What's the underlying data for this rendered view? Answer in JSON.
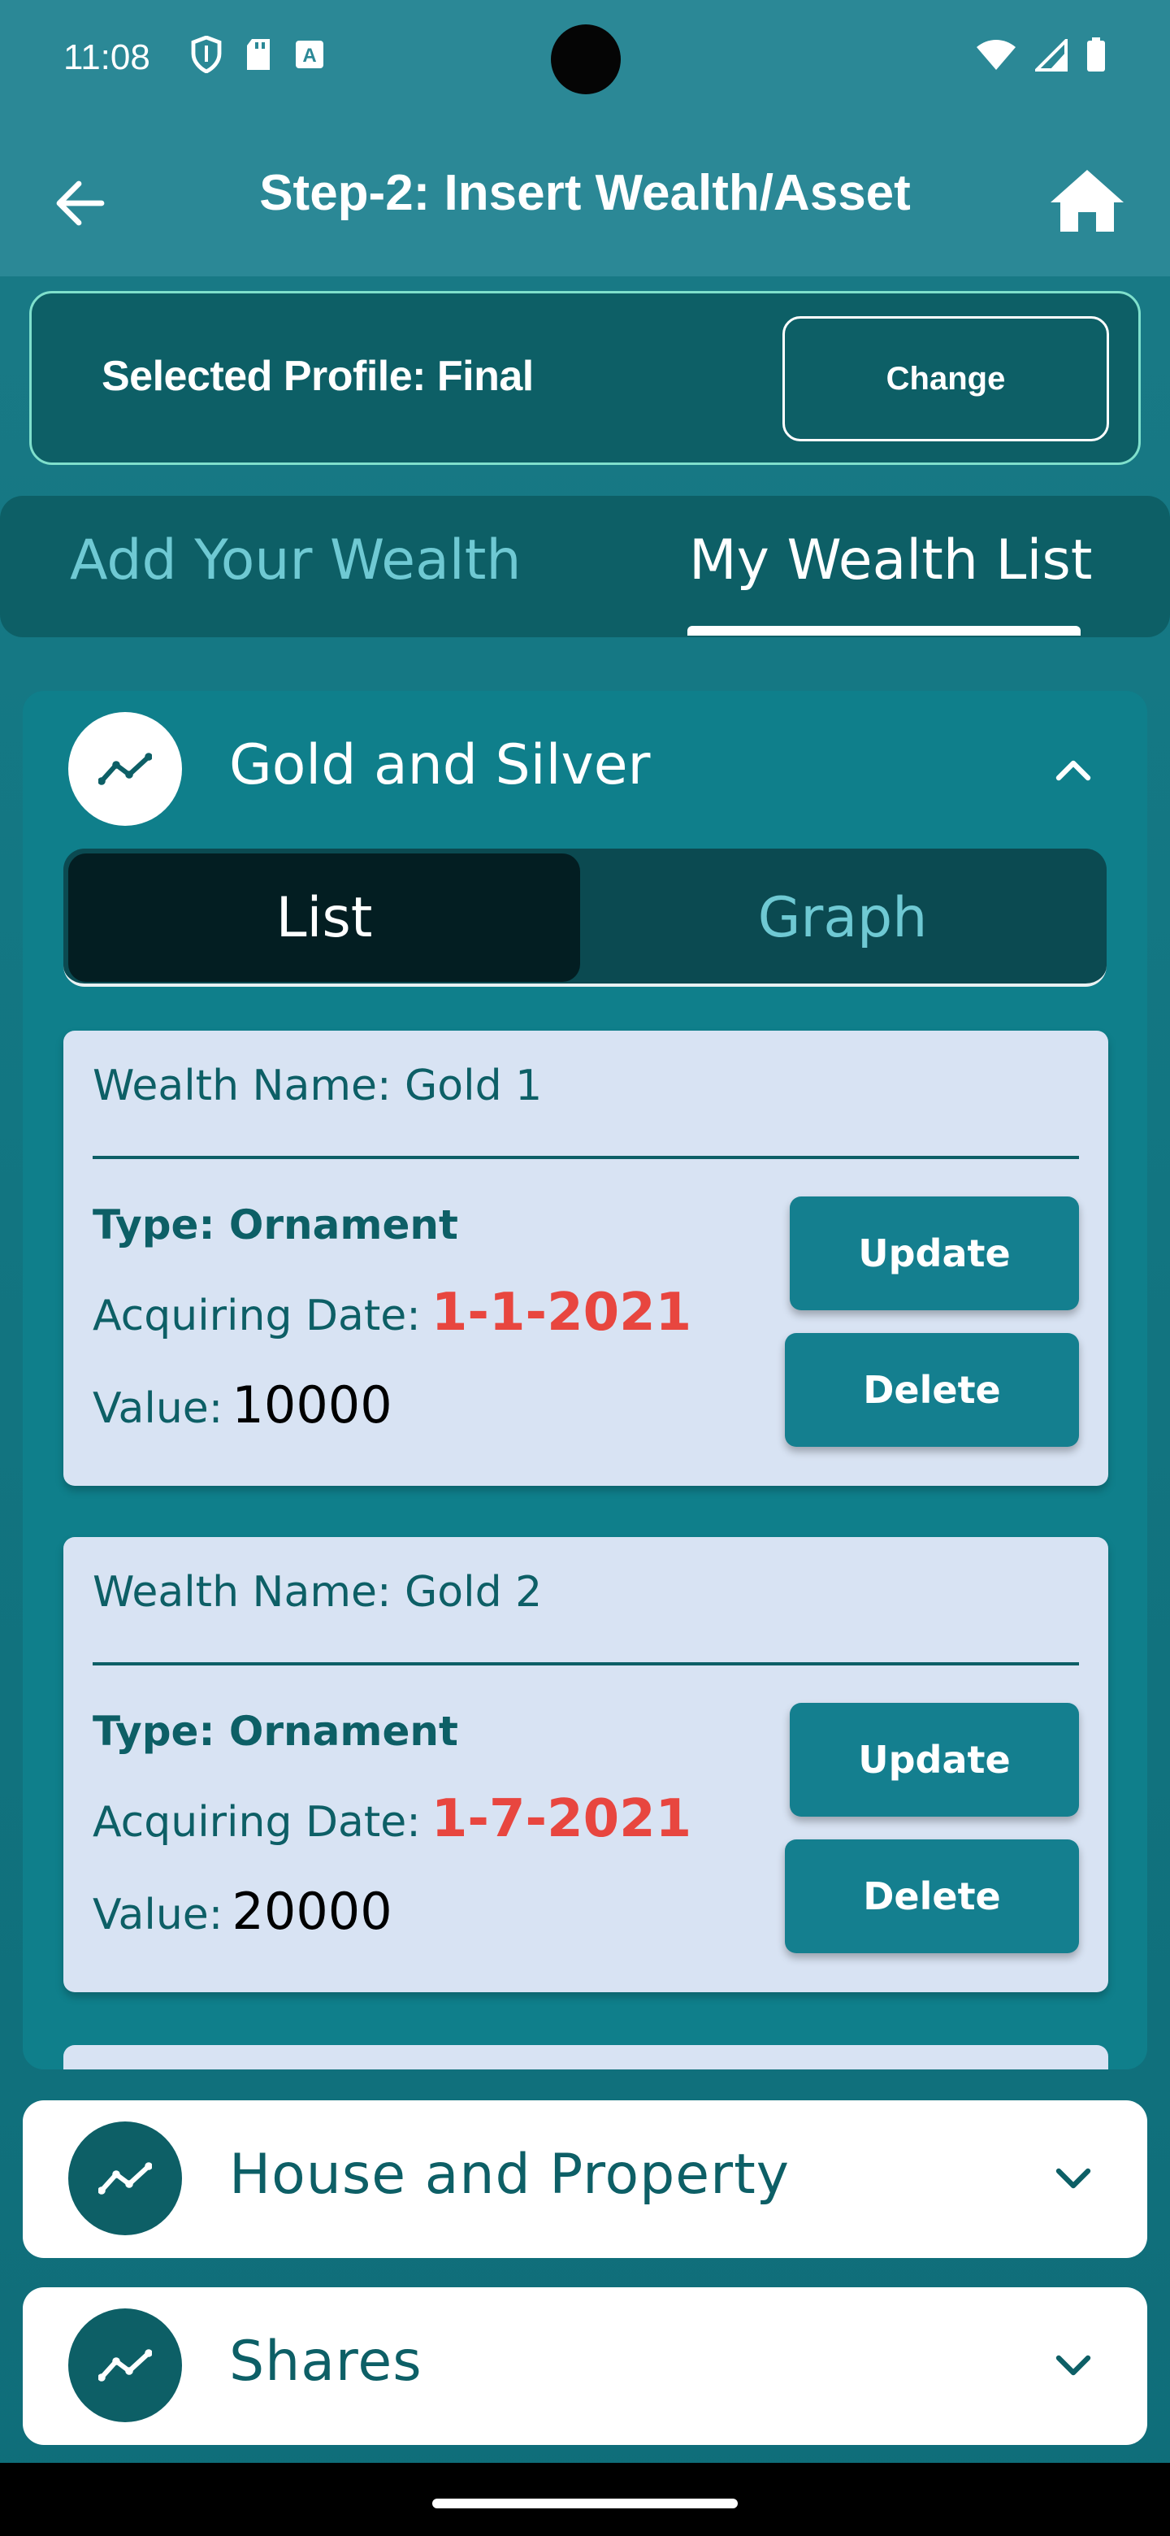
{
  "status_bar": {
    "time": "11:08"
  },
  "app_bar": {
    "title": "Step-2: Insert Wealth/Asset"
  },
  "profile": {
    "label": "Selected Profile: Final",
    "change_label": "Change"
  },
  "tabs": [
    {
      "label": "Add Your Wealth",
      "selected": false
    },
    {
      "label": "My Wealth List",
      "selected": true
    }
  ],
  "expanded_category": {
    "title": "Gold and Silver",
    "segments": {
      "list": "List",
      "graph": "Graph",
      "selected": "List"
    },
    "items": [
      {
        "name": "Wealth Name: Gold 1",
        "type": "Type: Ornament",
        "date_label": "Acquiring Date:",
        "date_value": "1-1-2021",
        "value_label": "Value:",
        "value": "10000",
        "update_label": "Update",
        "delete_label": "Delete"
      },
      {
        "name": "Wealth Name: Gold 2",
        "type": "Type: Ornament",
        "date_label": "Acquiring Date:",
        "date_value": "1-7-2021",
        "value_label": "Value:",
        "value": "20000",
        "update_label": "Update",
        "delete_label": "Delete"
      }
    ]
  },
  "collapsed_categories": [
    {
      "title": "House and Property"
    },
    {
      "title": "Shares"
    }
  ],
  "colors": {
    "app_bar": "#2b8896",
    "dark_teal": "#0d5f66",
    "card_bg": "#d8e3f3",
    "date_red": "#e8463f",
    "button": "#147f8f",
    "accent_border": "#7fe0cc"
  },
  "icons": {
    "back": "arrow-left-icon",
    "home": "home-icon",
    "category": "trending-line-icon",
    "expand": "chevron-up-icon",
    "collapse": "chevron-down-icon"
  }
}
